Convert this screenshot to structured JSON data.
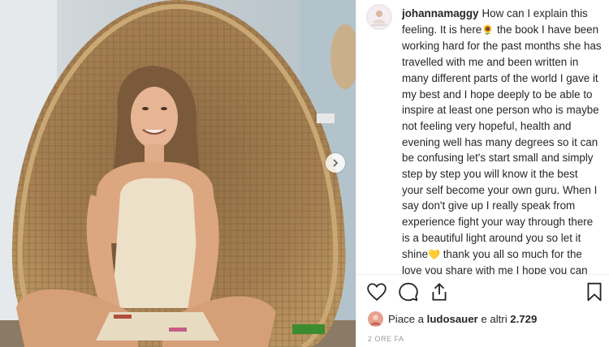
{
  "post": {
    "username": "johannamaggy",
    "caption_parts": {
      "p1": "How can I explain this feeling. It is here",
      "e1": "🌻",
      "p2": " the book I have been working hard for the past months she has travelled with me and been written in many different parts of the world I gave it my best and I hope deeply to be able to inspire at least one person who is maybe not feeling very hopeful, health and evening well has many degrees so it can be confusing let's start small and simply step by step you will know it the best your self become your own guru. When I say don't give up I really speak from experience fight your way through there is a beautiful light around you so let it shine",
      "e2": "💛",
      "p3": " thank you all so much for the love you share with me I hope you can feel I send all my love back",
      "e3": "🌍",
      "e4": "💛"
    },
    "likes": {
      "prefix": "Piace a",
      "user": "ludosauer",
      "middle": "e altri",
      "count": "2.729"
    },
    "time": "2 ORE FA"
  },
  "icons": {
    "like": "heart-icon",
    "comment": "comment-icon",
    "share": "share-icon",
    "save": "bookmark-icon",
    "next": "chevron-right-icon"
  },
  "colors": {
    "text": "#262626",
    "muted": "#999999",
    "border": "#efefef"
  }
}
